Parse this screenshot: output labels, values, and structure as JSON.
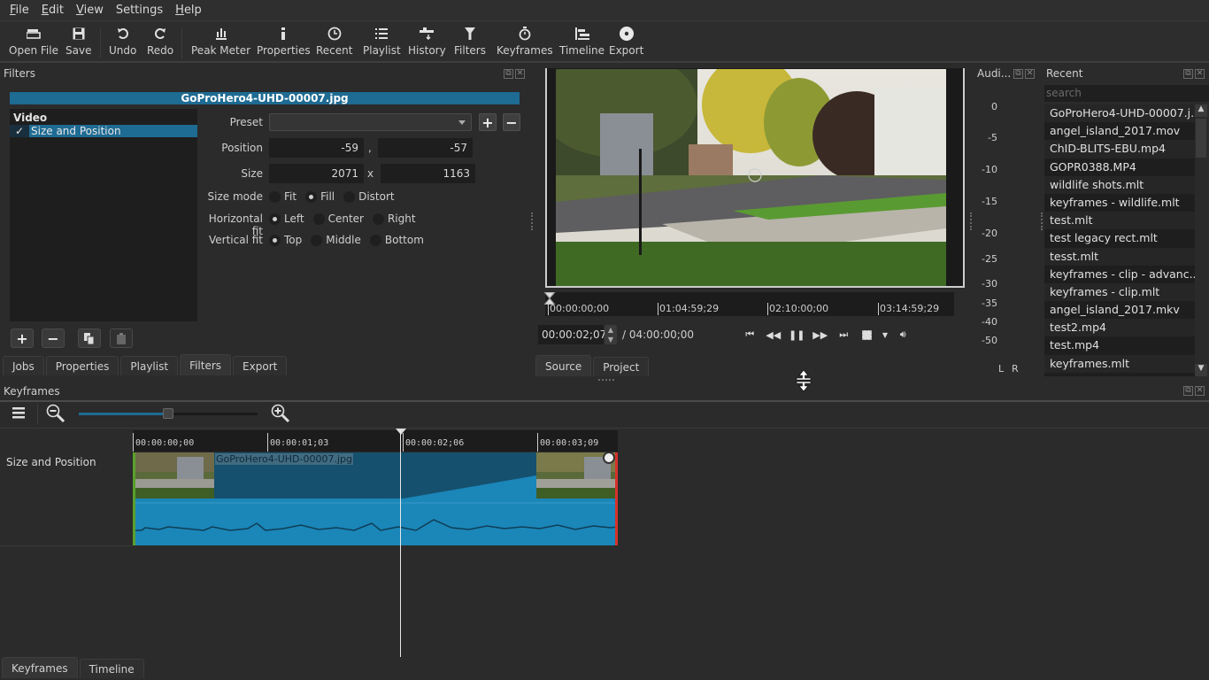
{
  "menubar": {
    "items": [
      {
        "label": "File",
        "mnemonic": "F",
        "rest": "ile"
      },
      {
        "label": "Edit",
        "mnemonic": "E",
        "rest": "dit"
      },
      {
        "label": "View",
        "mnemonic": "V",
        "rest": "iew"
      },
      {
        "label": "Settings",
        "mnemonic": "",
        "rest": "Settings"
      },
      {
        "label": "Help",
        "mnemonic": "H",
        "rest": "elp"
      }
    ]
  },
  "toolbar": {
    "open_file": "Open File",
    "save": "Save",
    "undo": "Undo",
    "redo": "Redo",
    "peak_meter": "Peak Meter",
    "properties": "Properties",
    "recent": "Recent",
    "playlist": "Playlist",
    "history": "History",
    "filters": "Filters",
    "keyframes": "Keyframes",
    "timeline": "Timeline",
    "export": "Export"
  },
  "filters_panel": {
    "title": "Filters",
    "clip_name": "GoProHero4-UHD-00007.jpg",
    "group_label": "Video",
    "items": [
      {
        "label": "Size and Position",
        "checked": true,
        "selected": true
      }
    ],
    "preset_label": "Preset",
    "preset_value": "",
    "position_label": "Position",
    "position_x": "-59",
    "position_sep": ",",
    "position_y": "-57",
    "size_label": "Size",
    "size_w": "2071",
    "size_sep": "x",
    "size_h": "1163",
    "size_mode_label": "Size mode",
    "size_mode_options": [
      "Fit",
      "Fill",
      "Distort"
    ],
    "size_mode_selected": "Fill",
    "hfit_label": "Horizontal fit",
    "hfit_options": [
      "Left",
      "Center",
      "Right"
    ],
    "hfit_selected": "Left",
    "vfit_label": "Vertical fit",
    "vfit_options": [
      "Top",
      "Middle",
      "Bottom"
    ],
    "vfit_selected": "Top"
  },
  "left_tabs": [
    {
      "label": "Jobs",
      "active": false
    },
    {
      "label": "Properties",
      "active": false
    },
    {
      "label": "Playlist",
      "active": false
    },
    {
      "label": "Filters",
      "active": true
    },
    {
      "label": "Export",
      "active": false
    }
  ],
  "player": {
    "ruler_labels": [
      "00:00:00;00",
      "01:04:59;29",
      "02:10:00;00",
      "03:14:59;29"
    ],
    "current_time": "00:00:02;07",
    "duration": "/ 04:00:00;00",
    "tabs": [
      {
        "label": "Source",
        "active": true
      },
      {
        "label": "Project",
        "active": false
      }
    ]
  },
  "audio_meter": {
    "title": "Audi...",
    "scale": [
      "0",
      "-5",
      "-10",
      "-15",
      "-20",
      "-25",
      "-30",
      "-35",
      "-40",
      "-50"
    ],
    "channels": [
      "L",
      "R"
    ]
  },
  "recent": {
    "title": "Recent",
    "search_placeholder": "search",
    "items": [
      "GoProHero4-UHD-00007.j...",
      "angel_island_2017.mov",
      "ChID-BLITS-EBU.mp4",
      "GOPR0388.MP4",
      "wildlife shots.mlt",
      "keyframes - wildlife.mlt",
      "test.mlt",
      "test legacy rect.mlt",
      "tesst.mlt",
      "keyframes - clip - advanc...",
      "keyframes - clip.mlt",
      "angel_island_2017.mkv",
      "test2.mp4",
      "test.mp4",
      "keyframes.mlt"
    ]
  },
  "keyframes": {
    "title": "Keyframes",
    "zoom_level": 0.5,
    "ruler_labels": [
      "00:00:00;00",
      "00:00:01;03",
      "00:00:02;06",
      "00:00:03;09"
    ],
    "track_name": "Size and Position",
    "clip_name": "GoProHero4-UHD-00007.jpg",
    "playhead_time": "00:00:02;07"
  },
  "bottom_tabs": [
    {
      "label": "Keyframes",
      "active": true
    },
    {
      "label": "Timeline",
      "active": false
    }
  ],
  "colors": {
    "accent": "#1e6b93",
    "background": "#2b2b2b",
    "clip_dark": "#15506e",
    "clip_light": "#1b86b8",
    "in_marker": "#5aa02c",
    "out_marker": "#d6322a"
  }
}
